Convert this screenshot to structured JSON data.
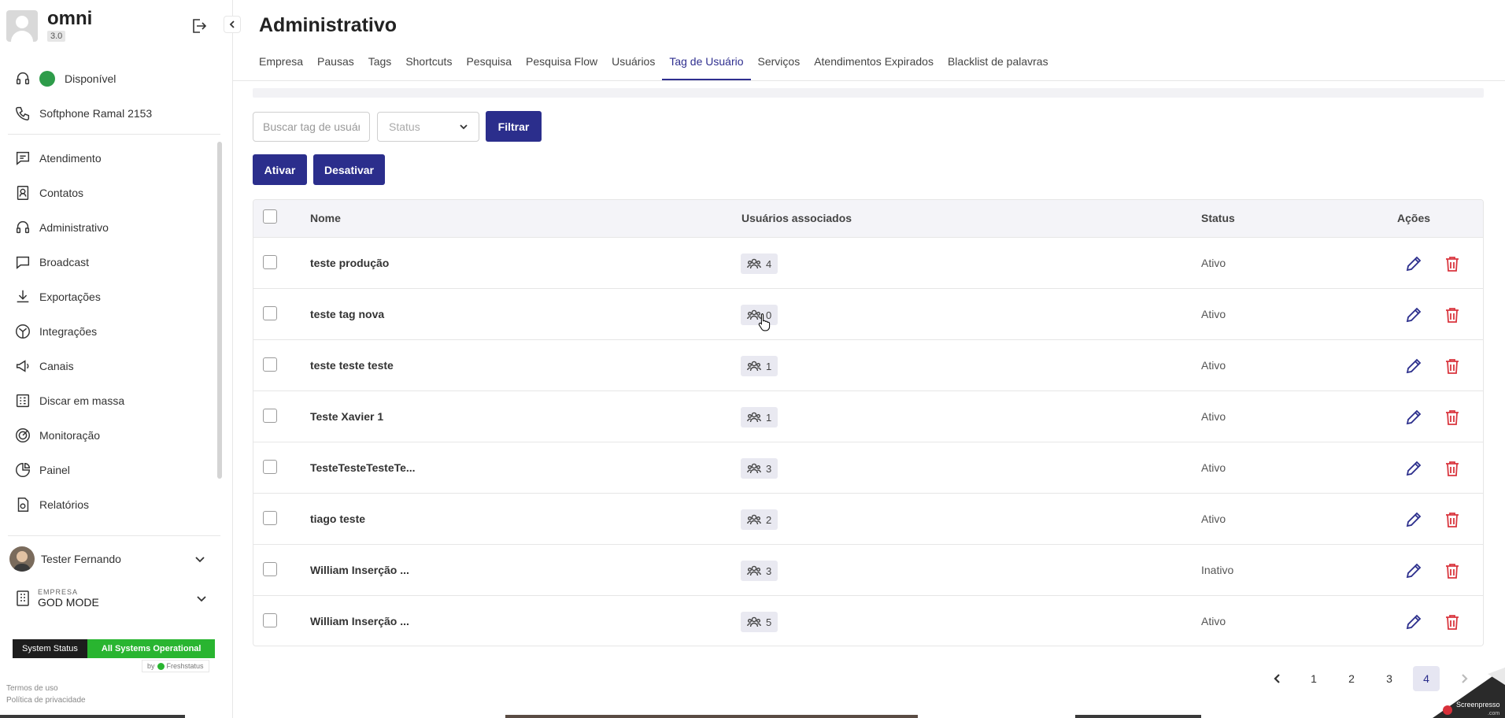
{
  "app": {
    "name": "omni",
    "version": "3.0"
  },
  "sidebar": {
    "presence": "Disponível",
    "softphone": "Softphone Ramal 2153",
    "items": [
      {
        "label": "Atendimento",
        "icon": "chat-icon"
      },
      {
        "label": "Contatos",
        "icon": "contacts-icon"
      },
      {
        "label": "Administrativo",
        "icon": "admin-icon"
      },
      {
        "label": "Broadcast",
        "icon": "broadcast-icon"
      },
      {
        "label": "Exportações",
        "icon": "download-icon"
      },
      {
        "label": "Integrações",
        "icon": "integrations-icon"
      },
      {
        "label": "Canais",
        "icon": "megaphone-icon"
      },
      {
        "label": "Discar em massa",
        "icon": "mass-dial-icon"
      },
      {
        "label": "Monitoração",
        "icon": "radar-icon"
      },
      {
        "label": "Painel",
        "icon": "pie-chart-icon"
      },
      {
        "label": "Relatórios",
        "icon": "report-icon"
      }
    ],
    "user": {
      "name": "Tester Fernando"
    },
    "company": {
      "label": "EMPRESA",
      "name": "GOD MODE"
    },
    "status_widget": {
      "label": "System Status",
      "state": "All Systems Operational",
      "by": "by",
      "provider": "Freshstatus"
    },
    "legal": {
      "terms": "Termos de uso",
      "privacy": "Política de privacidade"
    }
  },
  "page": {
    "title": "Administrativo",
    "tabs": [
      "Empresa",
      "Pausas",
      "Tags",
      "Shortcuts",
      "Pesquisa",
      "Pesquisa Flow",
      "Usuários",
      "Tag de Usuário",
      "Serviços",
      "Atendimentos Expirados",
      "Blacklist de palavras"
    ],
    "active_tab": "Tag de Usuário"
  },
  "filters": {
    "search_placeholder": "Buscar tag de usuário",
    "status_placeholder": "Status",
    "filter_button": "Filtrar"
  },
  "bulk_actions": {
    "activate": "Ativar",
    "deactivate": "Desativar"
  },
  "table": {
    "headers": {
      "name": "Nome",
      "users": "Usuários associados",
      "status": "Status",
      "actions": "Ações"
    },
    "rows": [
      {
        "name": "teste produção",
        "users": "4",
        "status": "Ativo"
      },
      {
        "name": "teste tag nova",
        "users": "0",
        "status": "Ativo"
      },
      {
        "name": "teste teste teste",
        "users": "1",
        "status": "Ativo"
      },
      {
        "name": "Teste Xavier 1",
        "users": "1",
        "status": "Ativo"
      },
      {
        "name": "TesteTesteTesteTe...",
        "users": "3",
        "status": "Ativo"
      },
      {
        "name": "tiago teste",
        "users": "2",
        "status": "Ativo"
      },
      {
        "name": "William Inserção ...",
        "users": "3",
        "status": "Inativo"
      },
      {
        "name": "William Inserção ...",
        "users": "5",
        "status": "Ativo"
      }
    ]
  },
  "pagination": {
    "pages": [
      "1",
      "2",
      "3",
      "4"
    ],
    "current": "4"
  },
  "colors": {
    "primary": "#2b2e8c",
    "danger": "#d9363e",
    "available": "#2e9c4a",
    "operational": "#29b530"
  }
}
